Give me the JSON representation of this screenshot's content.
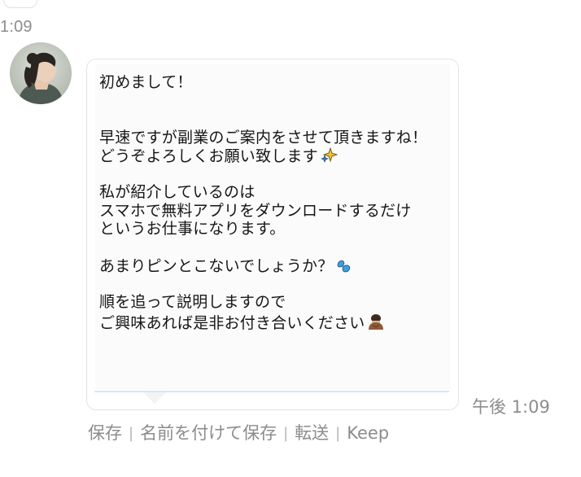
{
  "previous_message": {
    "time": "1:09"
  },
  "message": {
    "lines": [
      "初めまして！",
      "",
      "",
      "早速ですが副業のご案内をさせて頂きますね！",
      "どうぞよろしくお願い致します",
      "",
      "私が紹介しているのは",
      "スマホで無料アプリをダウンロードするだけ",
      "というお仕事になります。",
      "",
      "あまりピンとこないでしょうか？",
      "",
      "順を追って説明しますので",
      "ご興味あれば是非お付き合いください"
    ],
    "emojis": {
      "line_4": "sparkles-icon",
      "line_10": "sweat-drops-icon",
      "line_13": "bowing-person-icon"
    },
    "time": "午後 1:09"
  },
  "actions": {
    "save": "保存",
    "save_as": "名前を付けて保存",
    "forward": "転送",
    "keep": "Keep",
    "separator": "|"
  }
}
